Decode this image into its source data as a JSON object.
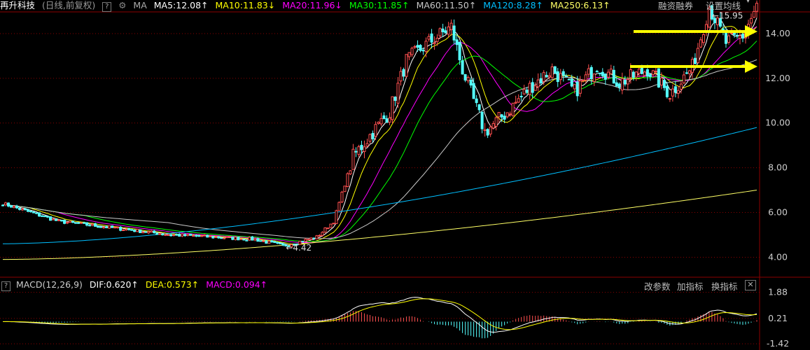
{
  "header": {
    "stock_name": "再升科技",
    "mode": "(日线,前复权)",
    "help": "?",
    "gear": "⚙",
    "ma_label": "MA",
    "ma": [
      {
        "text": "MA5:12.08↑",
        "color": "#ffffff"
      },
      {
        "text": "MA10:11.83↓",
        "color": "#ffff00"
      },
      {
        "text": "MA20:11.96↓",
        "color": "#ff00ff"
      },
      {
        "text": "MA30:11.85↑",
        "color": "#00ff00"
      },
      {
        "text": "MA60:11.50↑",
        "color": "#c8c8c8"
      },
      {
        "text": "MA120:8.28↑",
        "color": "#00bfff"
      },
      {
        "text": "MA250:6.13↑",
        "color": "#ffff66"
      }
    ],
    "margin_btn": "融资融券",
    "set_ma_btn": "设置均线"
  },
  "macd": {
    "help": "?",
    "title": "MACD(12,26,9)",
    "dif": "DIF:0.620↑",
    "dea": "DEA:0.573↑",
    "macd": "MACD:0.094↑",
    "btn_params": "改参数",
    "btn_add": "加指标",
    "btn_switch": "换指标",
    "btn_close": "✕"
  },
  "colors": {
    "up": "#ff5050",
    "down": "#54ffff",
    "grid": "#8b0000",
    "arrow": "#ffff00"
  },
  "chart_data": [
    {
      "type": "candlestick",
      "yticks": [
        4.0,
        6.0,
        8.0,
        10.0,
        12.0,
        14.0
      ],
      "ylim": [
        3.2,
        15.0
      ],
      "annotations": [
        {
          "text": "←4.42",
          "value": 4.42
        },
        {
          "text": "←15.95",
          "value": 15.95
        }
      ],
      "legend": [
        "MA5",
        "MA10",
        "MA20",
        "MA30",
        "MA60",
        "MA120",
        "MA250"
      ],
      "trend_keypoints": [
        {
          "i": 0,
          "c": 6.4
        },
        {
          "i": 20,
          "c": 5.6
        },
        {
          "i": 60,
          "c": 5.0
        },
        {
          "i": 90,
          "c": 4.8
        },
        {
          "i": 100,
          "c": 4.5
        },
        {
          "i": 112,
          "c": 4.9
        },
        {
          "i": 118,
          "c": 5.6
        },
        {
          "i": 125,
          "c": 8.5
        },
        {
          "i": 132,
          "c": 9.6
        },
        {
          "i": 138,
          "c": 10.5
        },
        {
          "i": 144,
          "c": 12.8
        },
        {
          "i": 152,
          "c": 13.6
        },
        {
          "i": 160,
          "c": 14.3
        },
        {
          "i": 164,
          "c": 12.4
        },
        {
          "i": 172,
          "c": 9.6
        },
        {
          "i": 180,
          "c": 10.5
        },
        {
          "i": 188,
          "c": 11.6
        },
        {
          "i": 196,
          "c": 12.4
        },
        {
          "i": 204,
          "c": 11.4
        },
        {
          "i": 212,
          "c": 12.6
        },
        {
          "i": 220,
          "c": 11.8
        },
        {
          "i": 230,
          "c": 12.4
        },
        {
          "i": 238,
          "c": 11.3
        },
        {
          "i": 246,
          "c": 12.5
        },
        {
          "i": 252,
          "c": 15.2
        },
        {
          "i": 258,
          "c": 13.6
        },
        {
          "i": 264,
          "c": 13.9
        },
        {
          "i": 269,
          "c": 15.2
        }
      ]
    },
    {
      "type": "macd",
      "yticks": [
        -1.42,
        0.21,
        1.88
      ],
      "ylim": [
        -1.55,
        2.0
      ],
      "series": [
        {
          "name": "DIF",
          "last": 0.62
        },
        {
          "name": "DEA",
          "last": 0.573
        },
        {
          "name": "MACD",
          "last": 0.094
        }
      ]
    }
  ]
}
